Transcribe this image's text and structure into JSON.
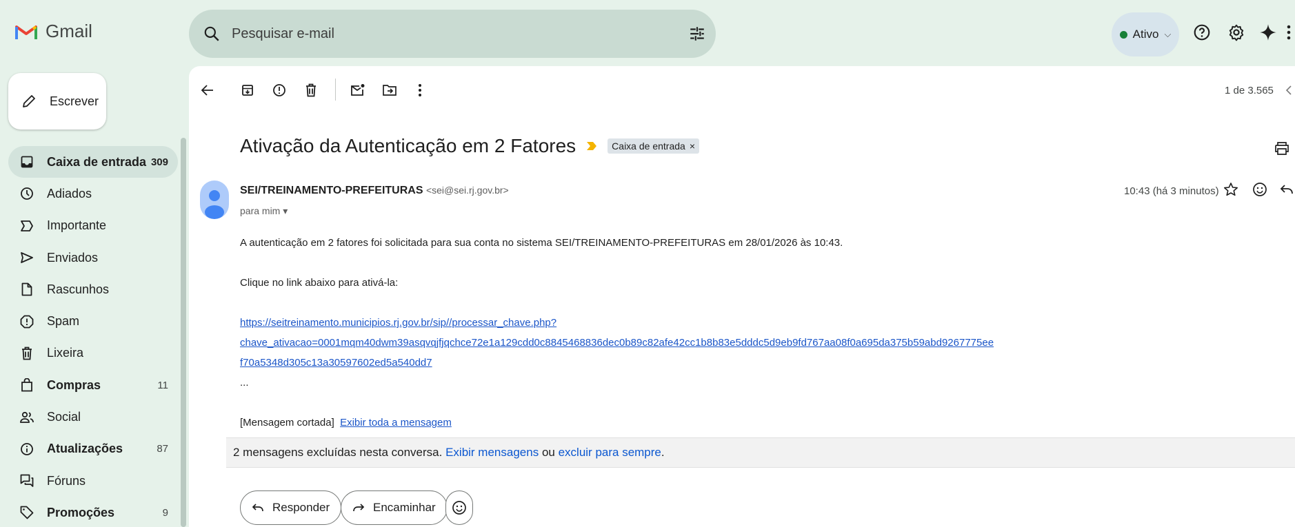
{
  "app": {
    "name": "Gmail"
  },
  "search": {
    "placeholder": "Pesquisar e-mail"
  },
  "header": {
    "status_label": "Ativo"
  },
  "sidebar": {
    "compose_label": "Escrever",
    "items": [
      {
        "label": "Caixa de entrada",
        "count": "309",
        "icon": "inbox-icon"
      },
      {
        "label": "Adiados",
        "count": "",
        "icon": "clock-icon"
      },
      {
        "label": "Importante",
        "count": "",
        "icon": "important-icon"
      },
      {
        "label": "Enviados",
        "count": "",
        "icon": "send-icon"
      },
      {
        "label": "Rascunhos",
        "count": "",
        "icon": "draft-icon"
      },
      {
        "label": "Spam",
        "count": "",
        "icon": "spam-icon"
      },
      {
        "label": "Lixeira",
        "count": "",
        "icon": "trash-icon"
      },
      {
        "label": "Compras",
        "count": "11",
        "icon": "shopping-icon"
      },
      {
        "label": "Social",
        "count": "",
        "icon": "people-icon"
      },
      {
        "label": "Atualizações",
        "count": "87",
        "icon": "info-icon"
      },
      {
        "label": "Fóruns",
        "count": "",
        "icon": "forum-icon"
      },
      {
        "label": "Promoções",
        "count": "9",
        "icon": "tag-icon"
      }
    ]
  },
  "toolbar": {
    "pager": "1 de 3.565"
  },
  "email": {
    "subject": "Ativação da Autenticação em 2 Fatores",
    "label_chip": "Caixa de entrada",
    "sender_name": "SEI/TREINAMENTO-PREFEITURAS",
    "sender_email": "<sei@sei.rj.gov.br>",
    "to": "para mim",
    "time": "10:43 (há 3 minutos)",
    "body_line1": "A autenticação em 2 fatores foi solicitada para sua conta no sistema SEI/TREINAMENTO-PREFEITURAS em 28/01/2026 às 10:43.",
    "body_line2": "Clique no link abaixo para ativá-la:",
    "link_part1": "https://seitreinamento.municipios.rj.gov.br/sip//processar_chave.php?chave_ativacao=0001mqm40dwm39asqvqjfjqchce72e1a129cdd0c8845468836dec0b89c82afe42cc1b8b83e5dddc5d9eb9fd767aa08f0a695da375b59abd9267775ee",
    "link_part2": "f70a5348d305c13a30597602ed5a540dd7",
    "ellipsis": "...",
    "clipped": "[Mensagem cortada]",
    "view_full": "Exibir toda a mensagem"
  },
  "trash_notice": {
    "text": "2 mensagens excluídas nesta conversa.",
    "view": "Exibir mensagens",
    "or": "ou",
    "delete": "excluir para sempre",
    "period": "."
  },
  "actions": {
    "reply": "Responder",
    "forward": "Encaminhar"
  }
}
